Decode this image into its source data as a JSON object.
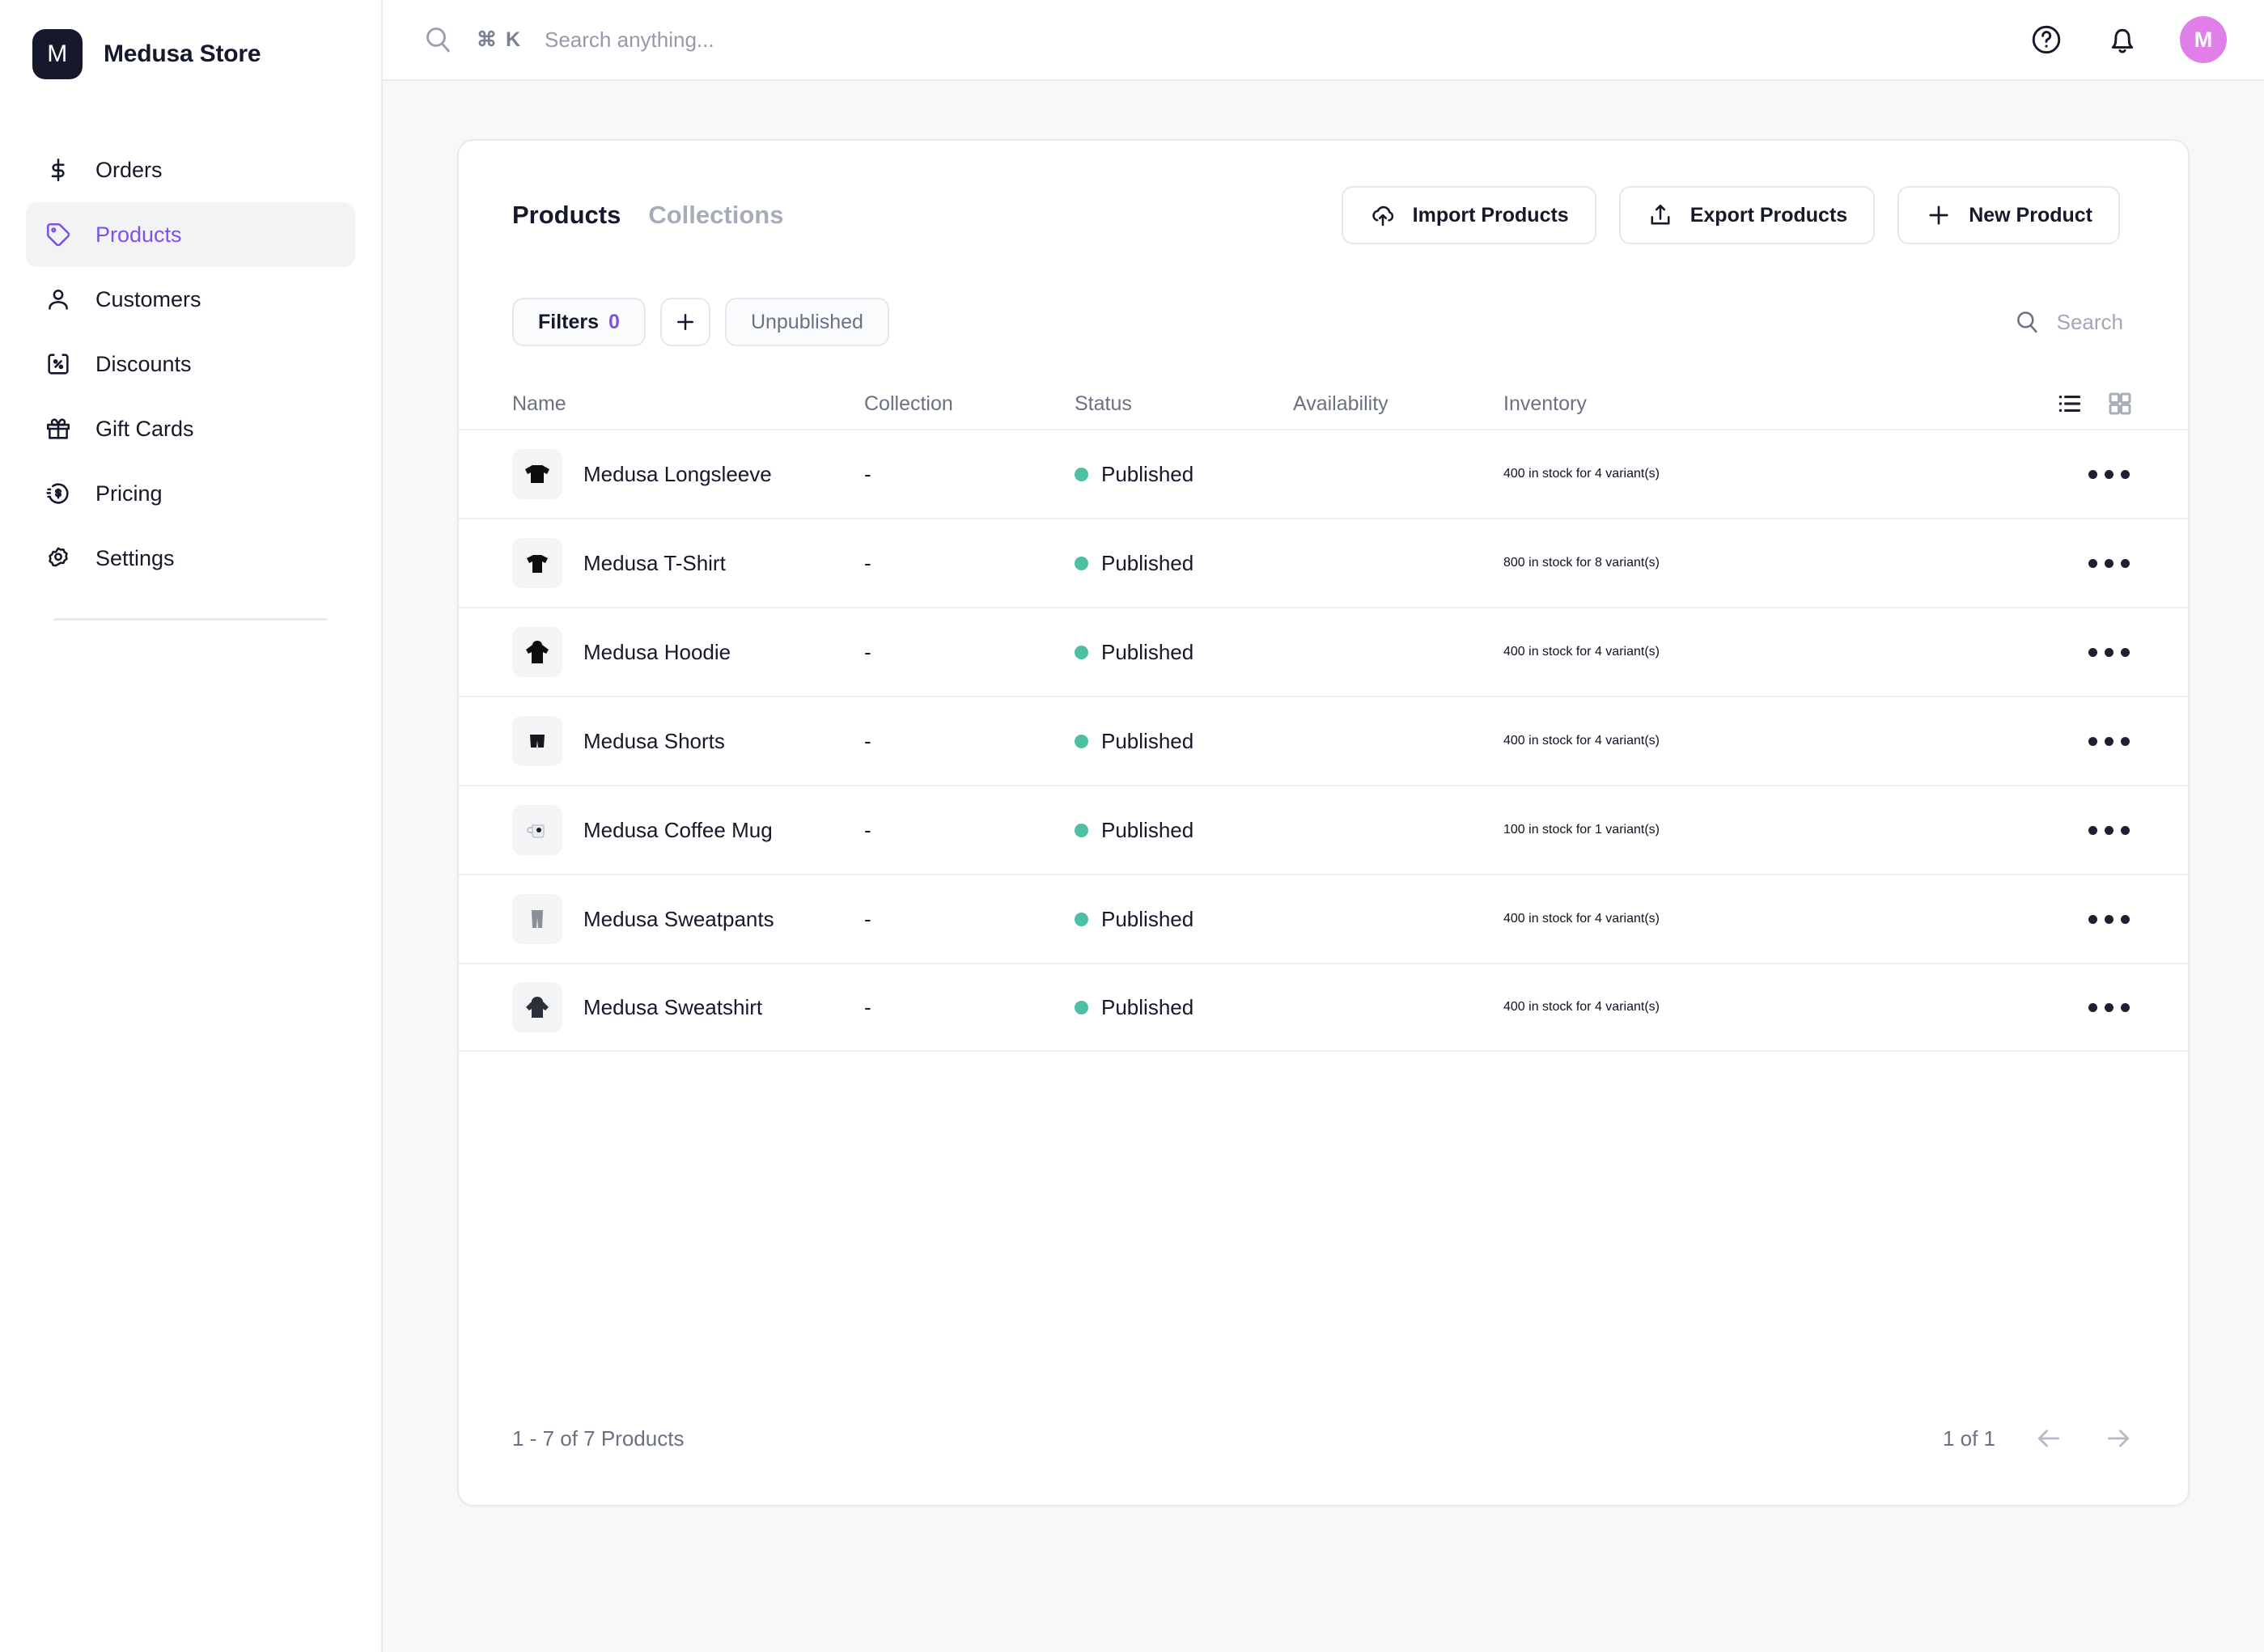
{
  "brand": {
    "initial": "M",
    "name": "Medusa Store"
  },
  "sidebar": {
    "items": [
      {
        "label": "Orders",
        "icon": "dollar-icon",
        "active": false
      },
      {
        "label": "Products",
        "icon": "tag-icon",
        "active": true
      },
      {
        "label": "Customers",
        "icon": "user-icon",
        "active": false
      },
      {
        "label": "Discounts",
        "icon": "percent-icon",
        "active": false
      },
      {
        "label": "Gift Cards",
        "icon": "gift-icon",
        "active": false
      },
      {
        "label": "Pricing",
        "icon": "coin-dollar-icon",
        "active": false
      },
      {
        "label": "Settings",
        "icon": "gear-icon",
        "active": false
      }
    ]
  },
  "topbar": {
    "search_shortcut": "⌘ K",
    "search_placeholder": "Search anything...",
    "help_icon": "help-circle-icon",
    "notifications_icon": "bell-icon",
    "avatar_initial": "M",
    "avatar_color": "#e07fe8"
  },
  "page": {
    "tabs": [
      {
        "label": "Products",
        "active": true
      },
      {
        "label": "Collections",
        "active": false
      }
    ],
    "actions": [
      {
        "label": "Import Products",
        "icon": "cloud-upload-icon"
      },
      {
        "label": "Export Products",
        "icon": "upload-icon"
      },
      {
        "label": "New Product",
        "icon": "plus-icon"
      }
    ],
    "filters": {
      "filters_label": "Filters",
      "filters_count": "0",
      "add_label": "+",
      "unpublished_label": "Unpublished"
    },
    "table_search_label": "Search",
    "view_modes": [
      {
        "name": "list",
        "active": true
      },
      {
        "name": "grid",
        "active": false
      }
    ],
    "columns": [
      "Name",
      "Collection",
      "Status",
      "Availability",
      "Inventory"
    ],
    "rows": [
      {
        "name": "Medusa Longsleeve",
        "thumb": "longsleeve",
        "collection": "-",
        "status": "Published",
        "availability": "",
        "inventory": "400 in stock for 4 variant(s)"
      },
      {
        "name": "Medusa T-Shirt",
        "thumb": "tshirt",
        "collection": "-",
        "status": "Published",
        "availability": "",
        "inventory": "800 in stock for 8 variant(s)"
      },
      {
        "name": "Medusa Hoodie",
        "thumb": "hoodie",
        "collection": "-",
        "status": "Published",
        "availability": "",
        "inventory": "400 in stock for 4 variant(s)"
      },
      {
        "name": "Medusa Shorts",
        "thumb": "shorts",
        "collection": "-",
        "status": "Published",
        "availability": "",
        "inventory": "400 in stock for 4 variant(s)"
      },
      {
        "name": "Medusa Coffee Mug",
        "thumb": "mug",
        "collection": "-",
        "status": "Published",
        "availability": "",
        "inventory": "100 in stock for 1 variant(s)"
      },
      {
        "name": "Medusa Sweatpants",
        "thumb": "sweatpants",
        "collection": "-",
        "status": "Published",
        "availability": "",
        "inventory": "400 in stock for 4 variant(s)"
      },
      {
        "name": "Medusa Sweatshirt",
        "thumb": "sweatshirt",
        "collection": "-",
        "status": "Published",
        "availability": "",
        "inventory": "400 in stock for 4 variant(s)"
      }
    ],
    "footer": {
      "range_label": "1 - 7 of 7 Products",
      "page_label": "1 of 1",
      "prev_icon": "arrow-left-icon",
      "next_icon": "arrow-right-icon"
    }
  },
  "colors": {
    "accent": "#7c52e8",
    "status_published": "#4fbfa3",
    "brand_dark": "#16182b",
    "page_bg": "#f7f8f9"
  }
}
